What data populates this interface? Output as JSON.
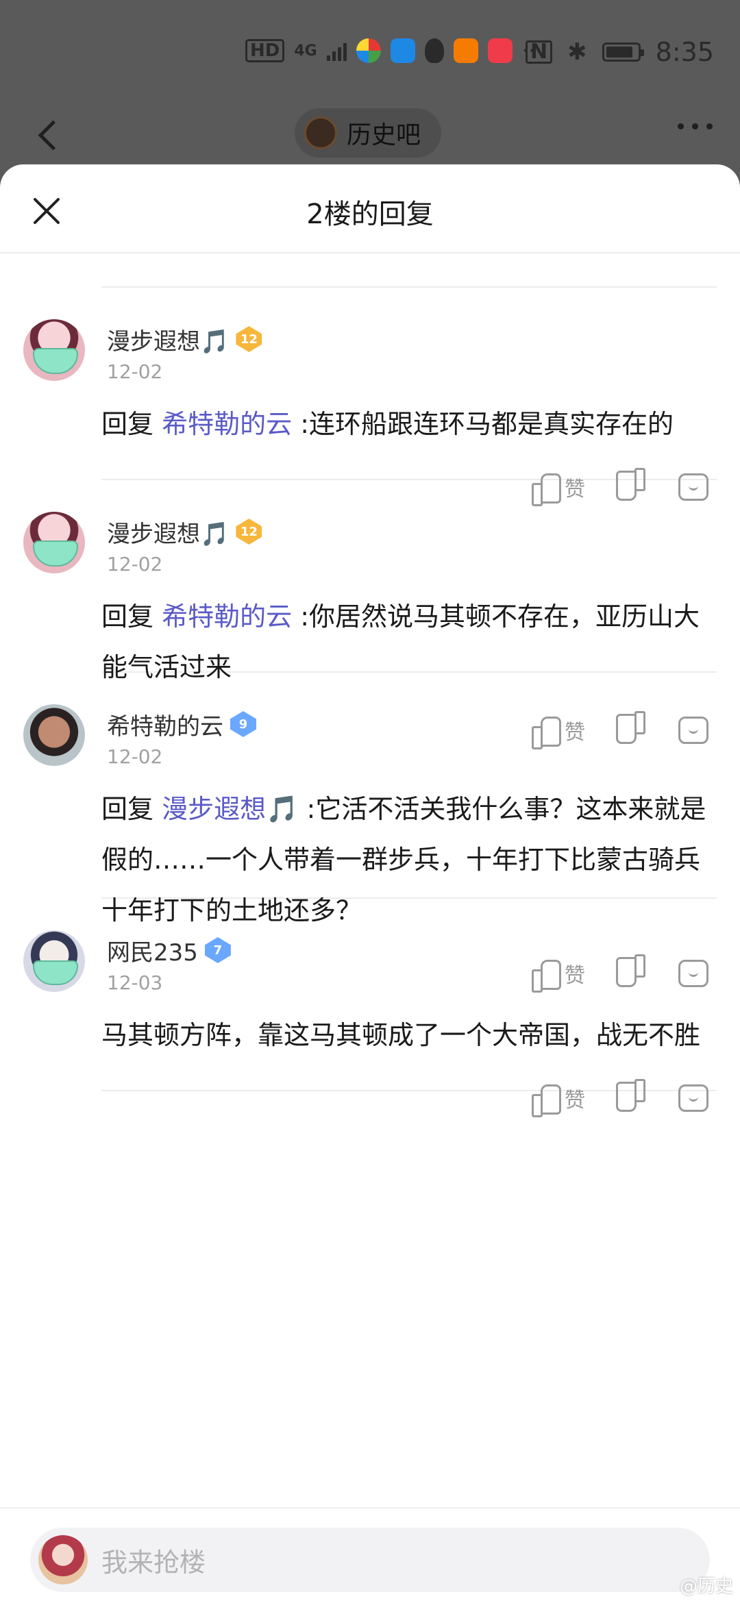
{
  "status_bar": {
    "network_hd": "HD",
    "network_type": "4G",
    "more": "···",
    "time": "8:35"
  },
  "top_nav": {
    "forum_name": "历史吧"
  },
  "sheet": {
    "title": "2楼的回复"
  },
  "replies": [
    {
      "username": "漫步遐想🎵",
      "level": "12",
      "date": "12-02",
      "prefix": "回复",
      "mention": "希特勒的云",
      "text": ":连环船跟连环马都是真实存在的",
      "like_label": "赞"
    },
    {
      "username": "漫步遐想🎵",
      "level": "12",
      "date": "12-02",
      "prefix": "回复",
      "mention": "希特勒的云",
      "text": ":你居然说马其顿不存在，亚历山大能气活过来",
      "like_label": "赞"
    },
    {
      "username": "希特勒的云",
      "level": "9",
      "date": "12-02",
      "prefix": "回复",
      "mention": "漫步遐想🎵",
      "text": ":它活不活关我什么事？这本来就是假的……一个人带着一群步兵，十年打下比蒙古骑兵十年打下的土地还多？",
      "like_label": "赞"
    },
    {
      "username": "网民235",
      "level": "7",
      "date": "12-03",
      "prefix": "",
      "mention": "",
      "text": "马其顿方阵，靠这马其顿成了一个大帝国，战无不胜",
      "like_label": "赞"
    }
  ],
  "bottom": {
    "input_placeholder": "我来抢楼",
    "watermark": "@历史"
  }
}
